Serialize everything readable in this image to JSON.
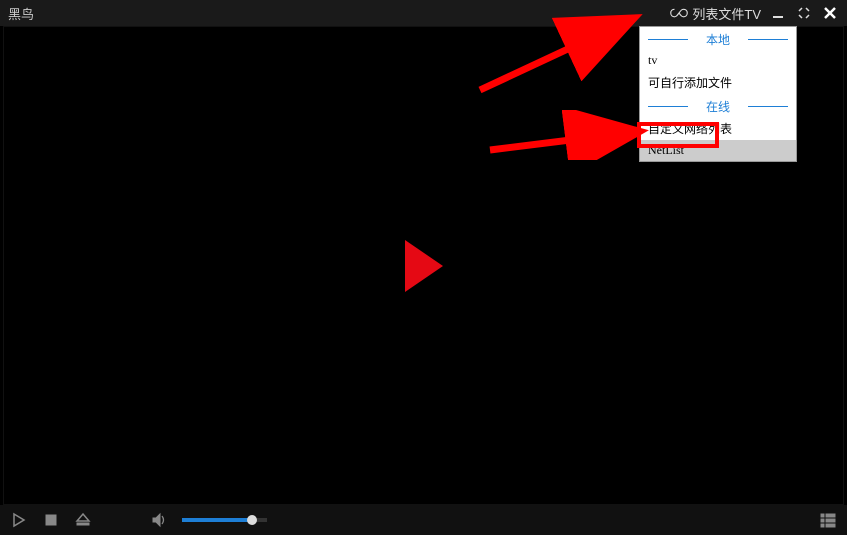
{
  "titlebar": {
    "app_title": "黑鸟",
    "list_button_label": "列表文件TV"
  },
  "dropdown": {
    "section_local": "本地",
    "items_local": [
      "tv",
      "可自行添加文件"
    ],
    "section_online": "在线",
    "items_online": [
      "自定义网络列表",
      "NetList"
    ]
  },
  "annotations": {
    "arrow1_target": "list-file-button",
    "arrow2_target": "netlist-item",
    "highlight_box_target": "netlist-item"
  }
}
